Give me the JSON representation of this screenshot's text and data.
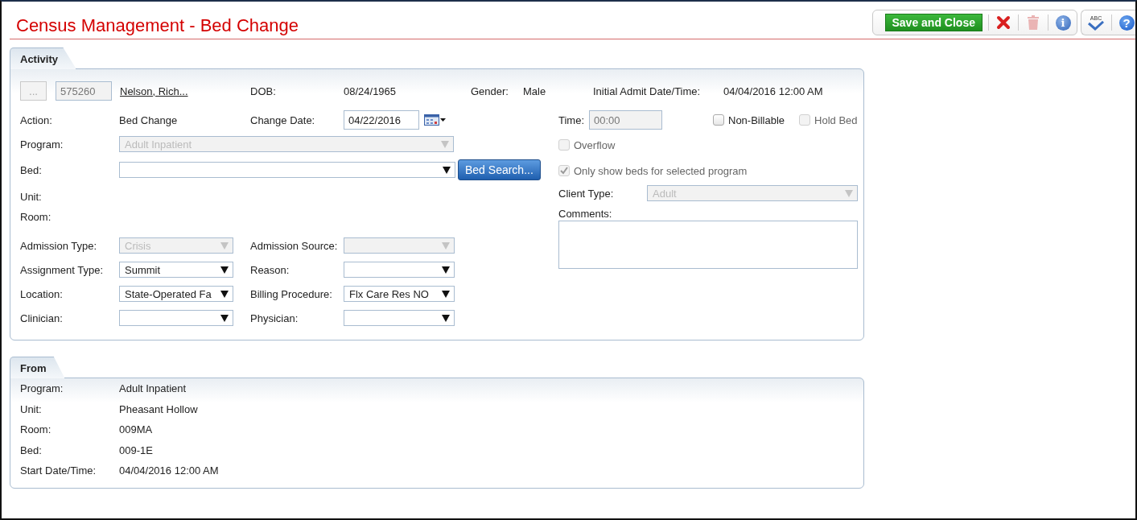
{
  "window": {
    "title": "Census Management - Bed Change"
  },
  "toolbar": {
    "save_button": "Save and Close",
    "cancel_disabled": false,
    "delete_disabled": true,
    "info_glyph": "i",
    "spellcheck_text": "ABC",
    "help_glyph": "?"
  },
  "activity": {
    "tab": "Activity",
    "lookup_button": {
      "label": "...",
      "disabled": true
    },
    "client_id": "575260",
    "client_name": "Nelson, Rich...",
    "info": [
      {
        "label": "DOB:",
        "value": "08/24/1965"
      },
      {
        "label": "Gender:",
        "value": "Male"
      },
      {
        "label": "Initial Admit Date/Time:",
        "value": "04/04/2016 12:00 AM"
      }
    ],
    "action": {
      "label": "Action:",
      "value": "Bed Change"
    },
    "change_date": {
      "label": "Change Date:",
      "value": "04/22/2016"
    },
    "program": {
      "label": "Program:",
      "value": "Adult Inpatient",
      "disabled": true
    },
    "bed": {
      "label": "Bed:",
      "disabled": false
    },
    "bed_search_button": "Bed Search...",
    "unit_label": "Unit:",
    "room_label": "Room:",
    "selects": [
      {
        "label": "Admission Type:",
        "value": "Crisis",
        "disabled": true
      },
      {
        "label": "Admission Source:",
        "disabled": true
      },
      {
        "label": "Assignment Type:",
        "value": "Summit",
        "disabled": false
      },
      {
        "label": "Reason:",
        "disabled": false
      },
      {
        "label": "Location:",
        "value": "State-Operated Fa",
        "disabled": false
      },
      {
        "label": "Billing Procedure:",
        "value": "Flx Care Res NO",
        "disabled": false
      },
      {
        "label": "Clinician:",
        "disabled": false
      },
      {
        "label": "Physician:",
        "disabled": false
      }
    ],
    "time": {
      "label": "Time:",
      "value": "00:00",
      "disabled": true
    },
    "time_checkboxes": [
      {
        "label": "Non-Billable",
        "checked": false,
        "disabled": false
      },
      {
        "label": "Hold Bed",
        "checked": false,
        "disabled": true
      }
    ],
    "options": [
      {
        "label": "Overflow",
        "checked": false,
        "disabled": true
      },
      {
        "label": "Only show beds for selected program",
        "checked": true,
        "disabled": true
      }
    ],
    "client_type": {
      "label": "Client Type:",
      "value": "Adult",
      "disabled": true
    },
    "comments_label": "Comments:"
  },
  "from": {
    "tab": "From",
    "rows": [
      {
        "label": "Program:",
        "value": "Adult Inpatient"
      },
      {
        "label": "Unit:",
        "value": "Pheasant Hollow"
      },
      {
        "label": "Room:",
        "value": "009MA"
      },
      {
        "label": "Bed:",
        "value": "009-1E"
      },
      {
        "label": "Start Date/Time:",
        "value": "04/04/2016 12:00 AM"
      }
    ]
  }
}
